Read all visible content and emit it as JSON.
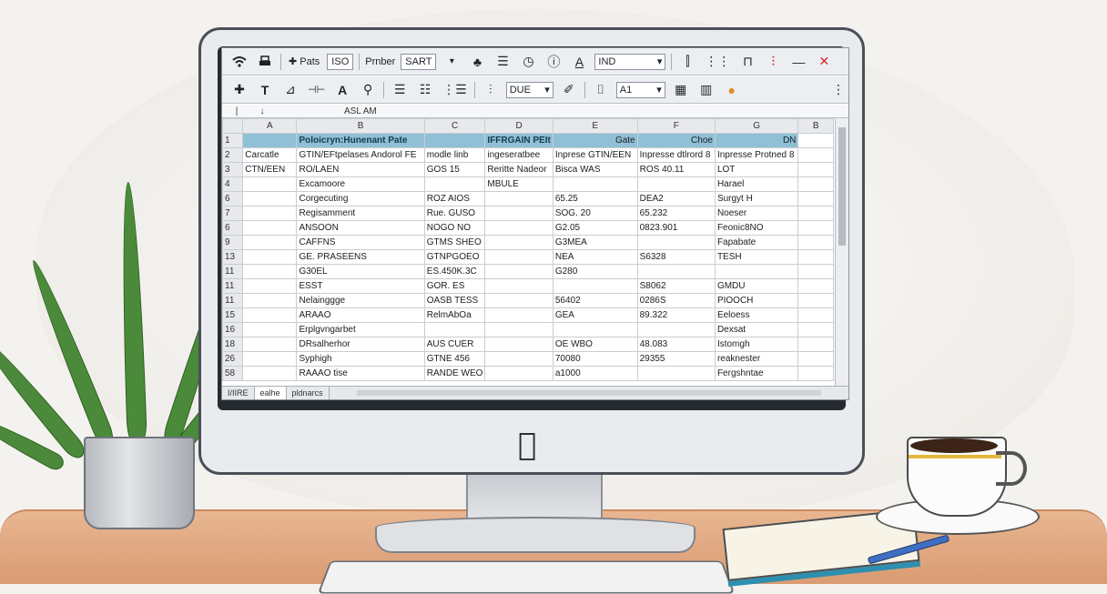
{
  "toolbar1": {
    "wifi": "wifi-icon",
    "print": "printer-icon",
    "plus_label": "✚ Pats",
    "box1": "ISO",
    "label": "Prnber",
    "box2": "SART",
    "drop": "▾",
    "drag_icon": "♣",
    "list_icon": "☰",
    "clock_icon": "◷",
    "info_icon": "ⓘ",
    "font_icon": "A",
    "select_value": "IND",
    "glyph1": "⫿",
    "glyph2": "⋮⋮",
    "glyph3": "⊓",
    "red_glyph": "⫶",
    "minimize": "—",
    "close": "✕"
  },
  "toolbar2": {
    "plus": "✚",
    "t": "T",
    "fill": "⊿",
    "align": "⊣⊢",
    "a": "A",
    "pin": "⚲",
    "l1": "☰",
    "l2": "☷",
    "l3": "⋮☰",
    "sort": "⫶",
    "select1": "DUE",
    "brush": "✐",
    "frame": "⌷",
    "select2": "A1",
    "grid_icon": "▦",
    "fmt_icon": "▥",
    "color_icon": "●",
    "more": "⋮"
  },
  "formula_bar": {
    "ref": "|",
    "fx": "↓",
    "content": "ASL AM"
  },
  "columns": [
    "",
    "A",
    "B",
    "C",
    "D",
    "E",
    "F",
    "G",
    "B"
  ],
  "rows": [
    [
      "1",
      "",
      "Poloicryn:Hunenant Pate",
      "",
      "IFFRGAIN PEIt",
      "Gate",
      "Choe",
      "DN"
    ],
    [
      "2",
      "Carcatle",
      "GTIN/EFtpelases Andorol FE",
      "modle linb",
      "ingeseratbee",
      "Inprese GTIN/EEN",
      "Inpresse dtlrord 8",
      "Inpresse Protned 8"
    ],
    [
      "3",
      "CTN/EEN",
      "RO/LAEN",
      "GOS 15",
      "Reritte Nadeor",
      "Bisca WAS",
      "ROS 40.11",
      "LOT"
    ],
    [
      "4",
      "",
      "Excamoore",
      "",
      "MBULE",
      "",
      "",
      "Harael"
    ],
    [
      "6",
      "",
      "Corgecuting",
      "ROZ AIOS",
      "",
      "65.25",
      "DEA2",
      "Surgyt H"
    ],
    [
      "7",
      "",
      "Regisamment",
      "Rue. GUSO",
      "",
      "SOG. 20",
      "65.232",
      "Noeser"
    ],
    [
      "6",
      "",
      "ANSOON",
      "NOGO NO",
      "",
      "G2.05",
      "0823.901",
      "Feonic8NO"
    ],
    [
      "9",
      "",
      "CAFFNS",
      "GTMS SHEO",
      "",
      "G3MEA",
      "",
      "Fapabate"
    ],
    [
      "13",
      "",
      "GE. PRASEENS",
      "GTNPGOEO",
      "",
      "NEA",
      "S6328",
      "TESH"
    ],
    [
      "11",
      "",
      "G30EL",
      "ES.450K.3C",
      "",
      "G280",
      "",
      ""
    ],
    [
      "11",
      "",
      "ESST",
      "GOR. ES",
      "",
      "",
      "S8062",
      "GMDU"
    ],
    [
      "11",
      "",
      "Nelainggge",
      "OASB TESS",
      "",
      "56402",
      "0286S",
      "PIOOCH"
    ],
    [
      "15",
      "",
      "ARAAO",
      "RelmAbOa",
      "",
      "GEA",
      "89.322",
      "Eeloess"
    ],
    [
      "16",
      "",
      "Erplgvngarbet",
      "",
      "",
      "",
      "",
      "Dexsat"
    ],
    [
      "18",
      "",
      "DRsalherhor",
      "AUS CUER",
      "",
      "OE WBO",
      "48.083",
      "Istomgh"
    ],
    [
      "26",
      "",
      "Syphigh",
      "GTNE 456",
      "",
      "70080",
      "29355",
      "reaknester"
    ],
    [
      "58",
      "",
      "RAAAO tise",
      "RANDE WEO",
      "",
      "a1000",
      "",
      "Fergshntae"
    ]
  ],
  "sheet_tabs": [
    "I/IIRE",
    "ealhe",
    "pldnarcs"
  ],
  "logo": "apple-logo",
  "colors": {
    "header_highlight": "#f4dc78",
    "banner": "#8fc0d6",
    "close_red": "#d6282c"
  }
}
